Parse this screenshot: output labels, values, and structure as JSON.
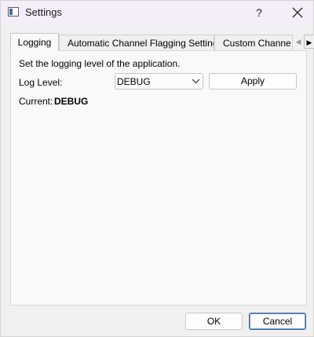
{
  "window": {
    "title": "Settings",
    "help_glyph": "?",
    "icon": "app-window-icon",
    "close_icon": "close-icon"
  },
  "tabs": [
    {
      "label": "Logging",
      "active": true
    },
    {
      "label": "Automatic Channel Flagging Settings",
      "active": false
    },
    {
      "label": "Custom Channe",
      "active": false
    }
  ],
  "tab_scroll": {
    "left_glyph": "◀",
    "right_glyph": "▶"
  },
  "logging": {
    "description": "Set the logging level of the application.",
    "log_level_label": "Log Level:",
    "log_level_value": "DEBUG",
    "apply_label": "Apply",
    "current_label": "Current:",
    "current_value": "DEBUG"
  },
  "footer": {
    "ok_label": "OK",
    "cancel_label": "Cancel"
  },
  "colors": {
    "titlebar_bg": "#f3eef7",
    "default_button_border": "#2f6fb8"
  }
}
